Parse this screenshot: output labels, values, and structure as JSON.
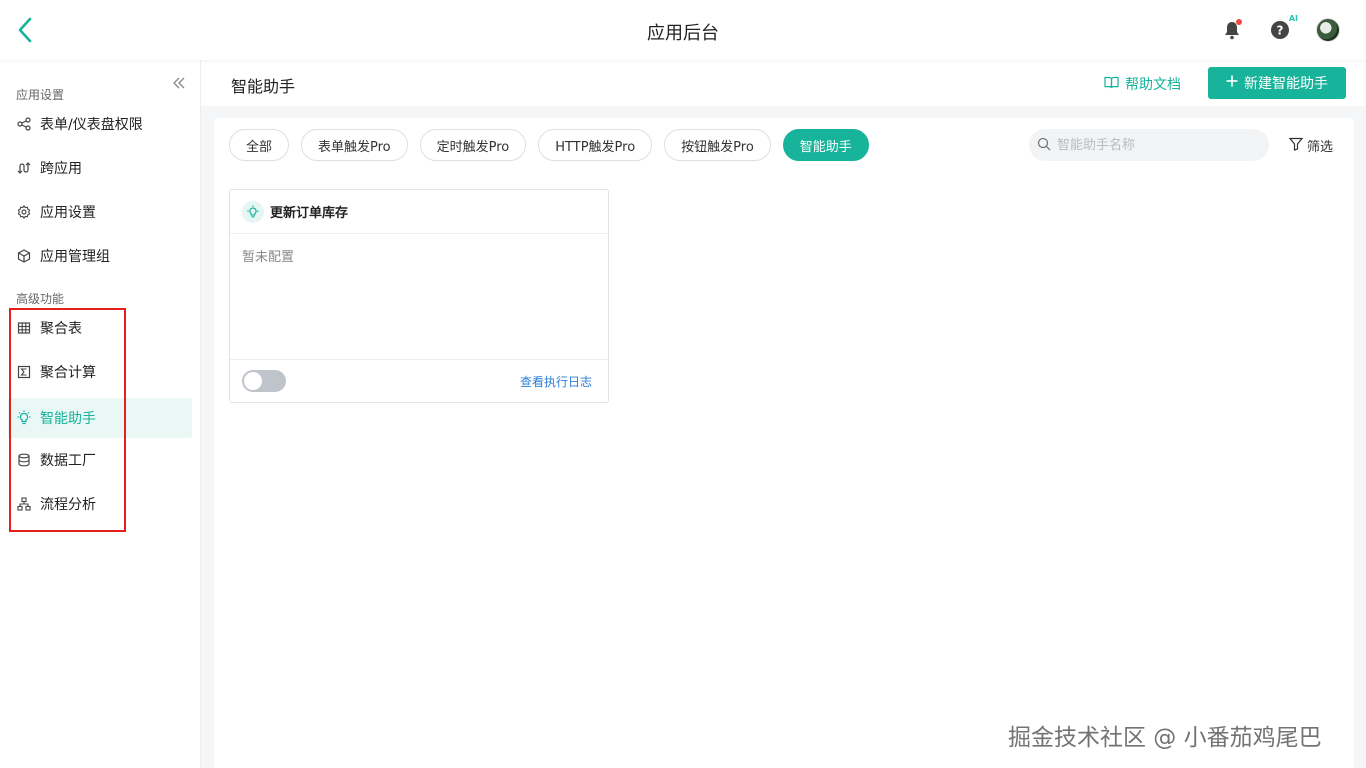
{
  "topbar": {
    "title": "应用后台",
    "ai_badge": "AI"
  },
  "sidebar": {
    "group1_label": "应用设置",
    "group1": [
      {
        "label": "表单/仪表盘权限",
        "icon": "share-icon"
      },
      {
        "label": "跨应用",
        "icon": "cross-app-icon"
      },
      {
        "label": "应用设置",
        "icon": "gear-icon"
      },
      {
        "label": "应用管理组",
        "icon": "cube-icon"
      }
    ],
    "group2_label": "高级功能",
    "group2": [
      {
        "label": "聚合表",
        "icon": "table-icon"
      },
      {
        "label": "聚合计算",
        "icon": "sigma-icon"
      },
      {
        "label": "智能助手",
        "icon": "bulb-icon",
        "active": true
      },
      {
        "label": "数据工厂",
        "icon": "database-icon"
      },
      {
        "label": "流程分析",
        "icon": "flow-icon"
      }
    ]
  },
  "header": {
    "title": "智能助手",
    "help_label": "帮助文档",
    "new_button": "新建智能助手"
  },
  "tabs": [
    "全部",
    "表单触发Pro",
    "定时触发Pro",
    "HTTP触发Pro",
    "按钮触发Pro",
    "智能助手"
  ],
  "active_tab": "智能助手",
  "search": {
    "placeholder": "智能助手名称"
  },
  "filter_label": "筛选",
  "card": {
    "title": "更新订单库存",
    "body": "暂未配置",
    "enabled": false,
    "log_link": "查看执行日志"
  },
  "watermark": "掘金技术社区 @ 小番茄鸡尾巴",
  "colors": {
    "accent": "#17b39a",
    "link": "#2a7fd6",
    "highlight": "#e5201a"
  }
}
